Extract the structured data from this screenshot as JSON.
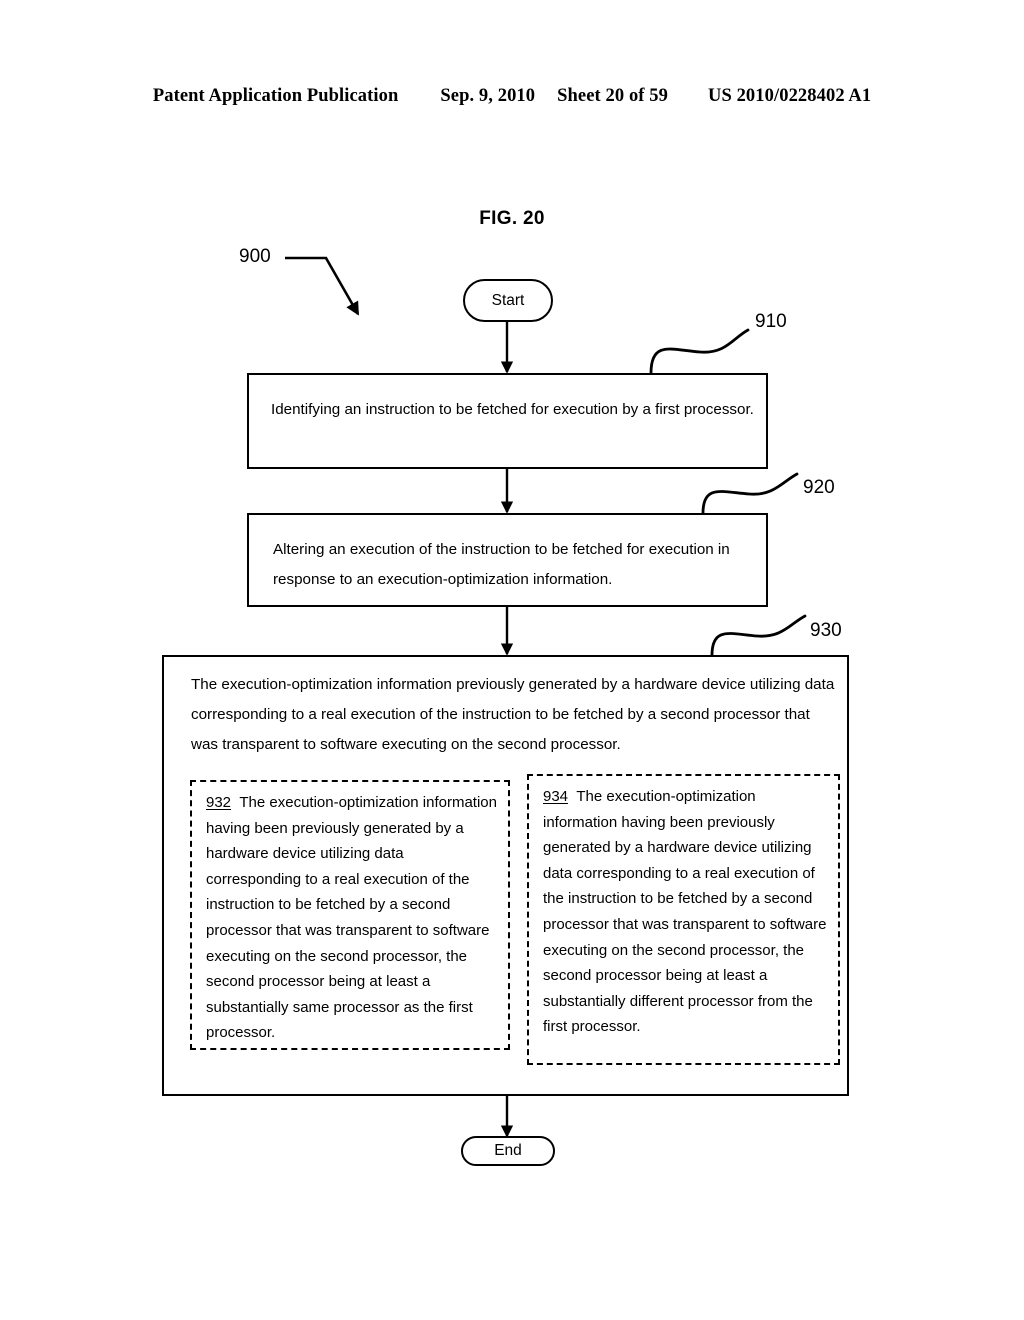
{
  "header": {
    "publication": "Patent Application Publication",
    "date": "Sep. 9, 2010",
    "sheet": "Sheet 20 of 59",
    "patent_number": "US 2010/0228402 A1"
  },
  "figure": {
    "title": "FIG. 20",
    "diagram_label": "900"
  },
  "flow": {
    "start_label": "Start",
    "end_label": "End",
    "steps": [
      {
        "ref": "910",
        "text": "Identifying an instruction to be fetched for execution by a first processor."
      },
      {
        "ref": "920",
        "text": "Altering an execution of the instruction to be fetched for execution in response to an execution-optimization information."
      },
      {
        "ref": "930",
        "text": "The execution-optimization information previously generated by a hardware device utilizing data corresponding to a real execution of the instruction to be fetched by a second processor that was transparent to software executing on the second processor."
      }
    ],
    "substeps": [
      {
        "ref": "932",
        "text": "The execution-optimization information having been previously generated by a hardware device utilizing data corresponding to a real execution of the instruction to be fetched by a second processor that was transparent to software executing on the second processor, the second processor being at least a substantially same processor as the first processor."
      },
      {
        "ref": "934",
        "text": "The execution-optimization information having been previously generated by a hardware device utilizing data corresponding to a real execution of the instruction to be fetched by a second processor that was transparent to software executing on the second processor, the second processor being at least a substantially different processor from the first processor."
      }
    ]
  },
  "colors": {
    "ink": "#000000",
    "paper": "#ffffff"
  }
}
